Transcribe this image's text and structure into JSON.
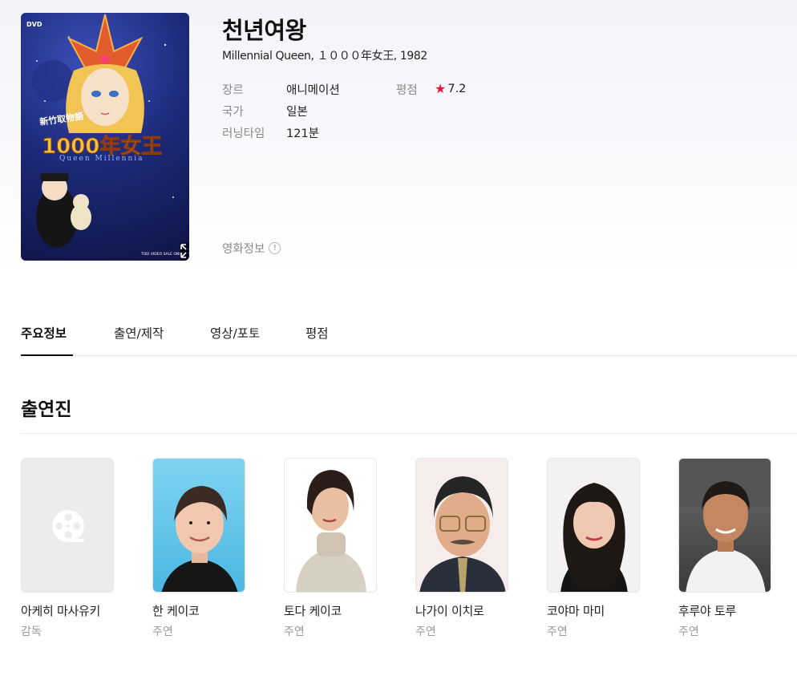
{
  "movie": {
    "title": "천년여왕",
    "subtitle": "Millennial Queen, １０００年女王, 1982",
    "poster_text": {
      "dvd_badge": "DVD",
      "logo_line1": "新竹取物語",
      "logo_line2": "1000年女王",
      "logo_line3": "Queen Millennia",
      "footer": "TOEI VIDEO SALE ONLY"
    },
    "genre_label": "장르",
    "genre_value": "애니메이션",
    "country_label": "국가",
    "country_value": "일본",
    "runtime_label": "러닝타임",
    "runtime_value": "121분",
    "rating_label": "평점",
    "rating_star": "★",
    "rating_value": "7.2",
    "movie_info_label": "영화정보",
    "movie_info_icon": "!"
  },
  "tabs": [
    {
      "label": "주요정보",
      "active": true
    },
    {
      "label": "출연/제작",
      "active": false
    },
    {
      "label": "영상/포토",
      "active": false
    },
    {
      "label": "평점",
      "active": false
    }
  ],
  "cast_section": {
    "title": "출연진",
    "members": [
      {
        "name": "아케히 마사유키",
        "role": "감독",
        "photo": "placeholder-film-icon"
      },
      {
        "name": "한 케이코",
        "role": "주연",
        "photo": "portrait"
      },
      {
        "name": "토다 케이코",
        "role": "주연",
        "photo": "portrait"
      },
      {
        "name": "나가이 이치로",
        "role": "주연",
        "photo": "portrait"
      },
      {
        "name": "코야마 마미",
        "role": "주연",
        "photo": "portrait"
      },
      {
        "name": "후루야 토루",
        "role": "주연",
        "photo": "portrait"
      }
    ]
  },
  "colors": {
    "accent_star": "#e5163a",
    "muted_text": "#8a8a8a",
    "tab_underline": "#111111"
  },
  "icons": {
    "expand": "expand-arrows-icon",
    "film_placeholder": "film-reel-icon",
    "info": "info-circle-icon",
    "rating": "star-icon"
  }
}
